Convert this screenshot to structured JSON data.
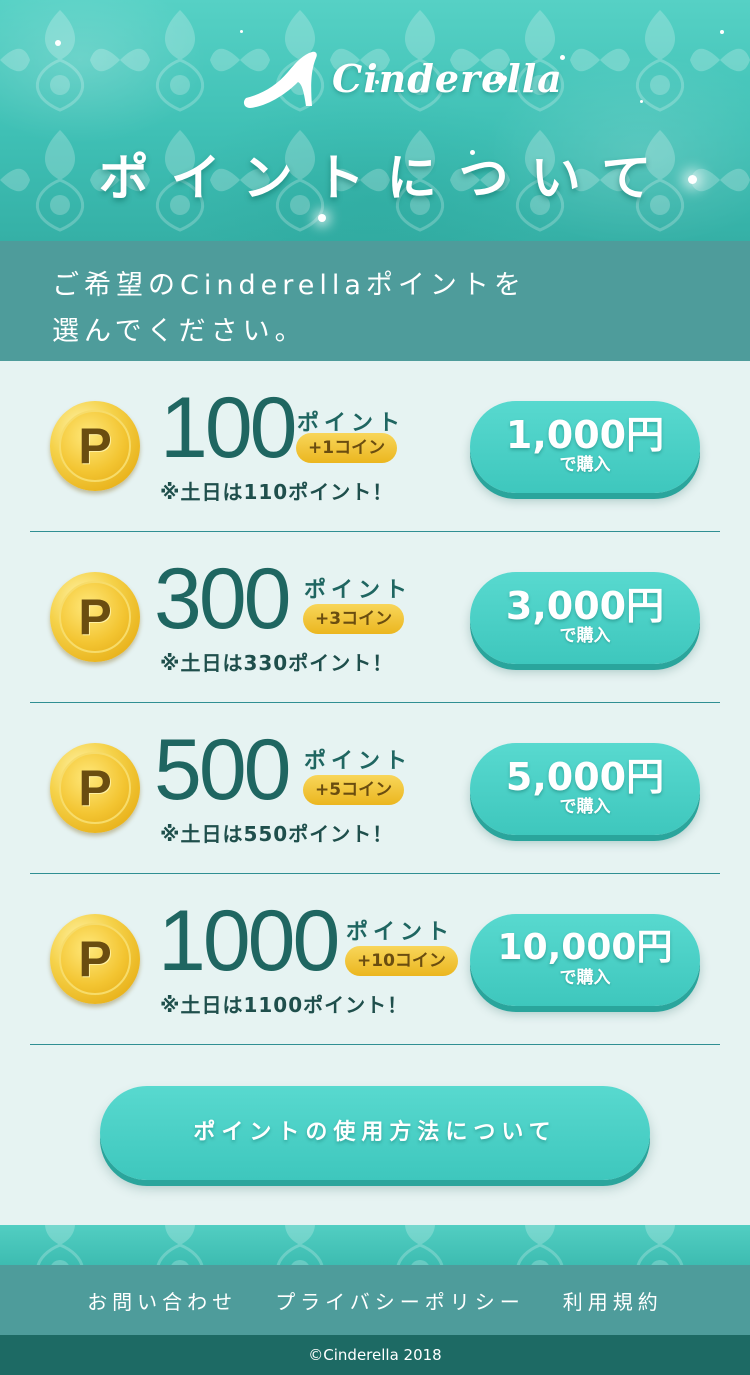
{
  "header": {
    "logo_text": "Cinderella",
    "title": "ポイントについて"
  },
  "intro": {
    "line1": "ご希望のCinderellaポイントを",
    "line2": "選んでください。"
  },
  "plans": [
    {
      "amount": "100",
      "unit": "ポイント",
      "bonus": "+1コイン",
      "weekend": "※土日は110ポイント！",
      "price": "1,000円",
      "price_sub": "で購入"
    },
    {
      "amount": "300",
      "unit": "ポイント",
      "bonus": "+3コイン",
      "weekend": "※土日は330ポイント！",
      "price": "3,000円",
      "price_sub": "で購入"
    },
    {
      "amount": "500",
      "unit": "ポイント",
      "bonus": "+5コイン",
      "weekend": "※土日は550ポイント！",
      "price": "5,000円",
      "price_sub": "で購入"
    },
    {
      "amount": "1000",
      "unit": "ポイント",
      "bonus": "+10コイン",
      "weekend": "※土日は1100ポイント！",
      "price": "10,000円",
      "price_sub": "で購入"
    }
  ],
  "coin_symbol": "P",
  "howto_button": "ポイントの使用方法について",
  "footer": {
    "links": [
      "お問い合わせ",
      "プライバシーポリシー",
      "利用規約"
    ],
    "copyright": "©Cinderella 2018"
  },
  "colors": {
    "teal": "#3fc0b5",
    "band": "#4e9c9b",
    "text_dark": "#1f6661",
    "coin_gold": "#f3c532"
  }
}
